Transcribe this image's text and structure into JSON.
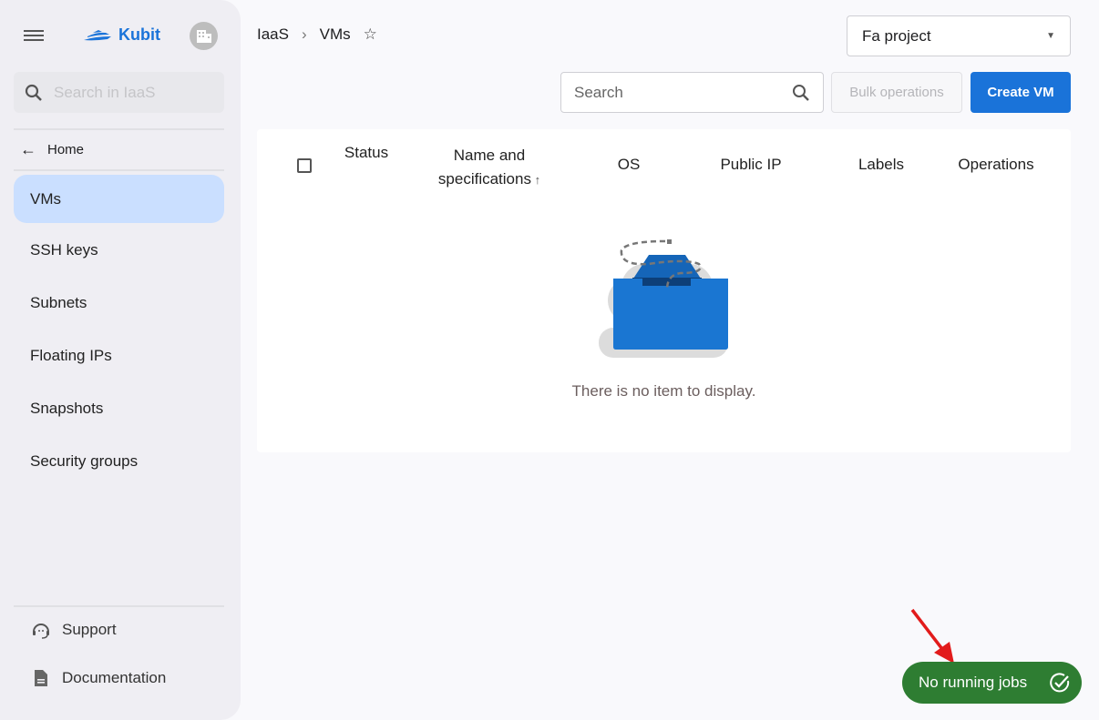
{
  "sidebar": {
    "brand": "Kubit",
    "search_placeholder": "Search in IaaS",
    "home": "Home",
    "items": [
      {
        "label": "VMs",
        "active": true
      },
      {
        "label": "SSH keys"
      },
      {
        "label": "Subnets"
      },
      {
        "label": "Floating IPs"
      },
      {
        "label": "Snapshots"
      },
      {
        "label": "Security groups"
      }
    ],
    "footer": [
      {
        "label": "Support",
        "icon": "headset-icon"
      },
      {
        "label": "Documentation",
        "icon": "document-icon"
      }
    ]
  },
  "breadcrumb": [
    "IaaS",
    "VMs"
  ],
  "project_select": {
    "value": "Fa project"
  },
  "toolbar": {
    "search_placeholder": "Search",
    "bulk_label": "Bulk operations",
    "create_label": "Create VM"
  },
  "table": {
    "columns": [
      "Status",
      "Name and specifications",
      "OS",
      "Public IP",
      "Labels",
      "Operations"
    ],
    "empty_text": "There is no item to display."
  },
  "jobs": {
    "label": "No running jobs",
    "color": "#2e7d32"
  },
  "colors": {
    "accent": "#1a73d9",
    "active_nav": "#cadfff"
  }
}
